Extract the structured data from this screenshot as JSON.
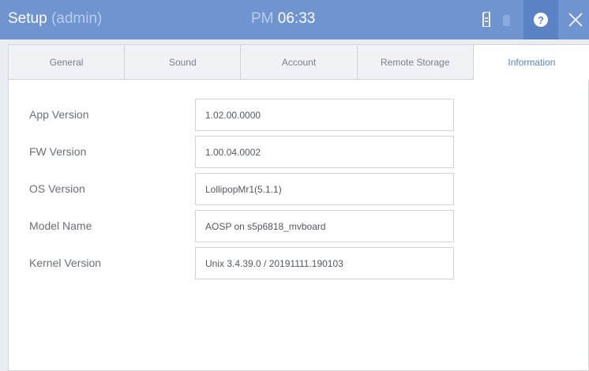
{
  "header": {
    "title": "Setup",
    "title_sub": "(admin)",
    "clock_ampm": "PM",
    "clock_time": "06:33"
  },
  "icons": {
    "sd_card": "sd-card-icon",
    "battery": "battery-icon",
    "help": "help-icon",
    "close": "close-icon",
    "help_glyph": "?"
  },
  "colors": {
    "titlebar": "#6f94cf",
    "help_button": "#5a82c4",
    "active_tab": "#5a82c4"
  },
  "tabs": [
    {
      "label": "General"
    },
    {
      "label": "Sound"
    },
    {
      "label": "Account"
    },
    {
      "label": "Remote Storage"
    },
    {
      "label": "Information"
    }
  ],
  "active_tab": "Information",
  "info": [
    {
      "label": "App Version",
      "value": "1.02.00.0000"
    },
    {
      "label": "FW Version",
      "value": "1.00.04.0002"
    },
    {
      "label": "OS Version",
      "value": "LollipopMr1(5.1.1)"
    },
    {
      "label": "Model Name",
      "value": "AOSP on s5p6818_mvboard"
    },
    {
      "label": "Kernel Version",
      "value": "Unix 3.4.39.0 / 20191111.190103"
    }
  ]
}
